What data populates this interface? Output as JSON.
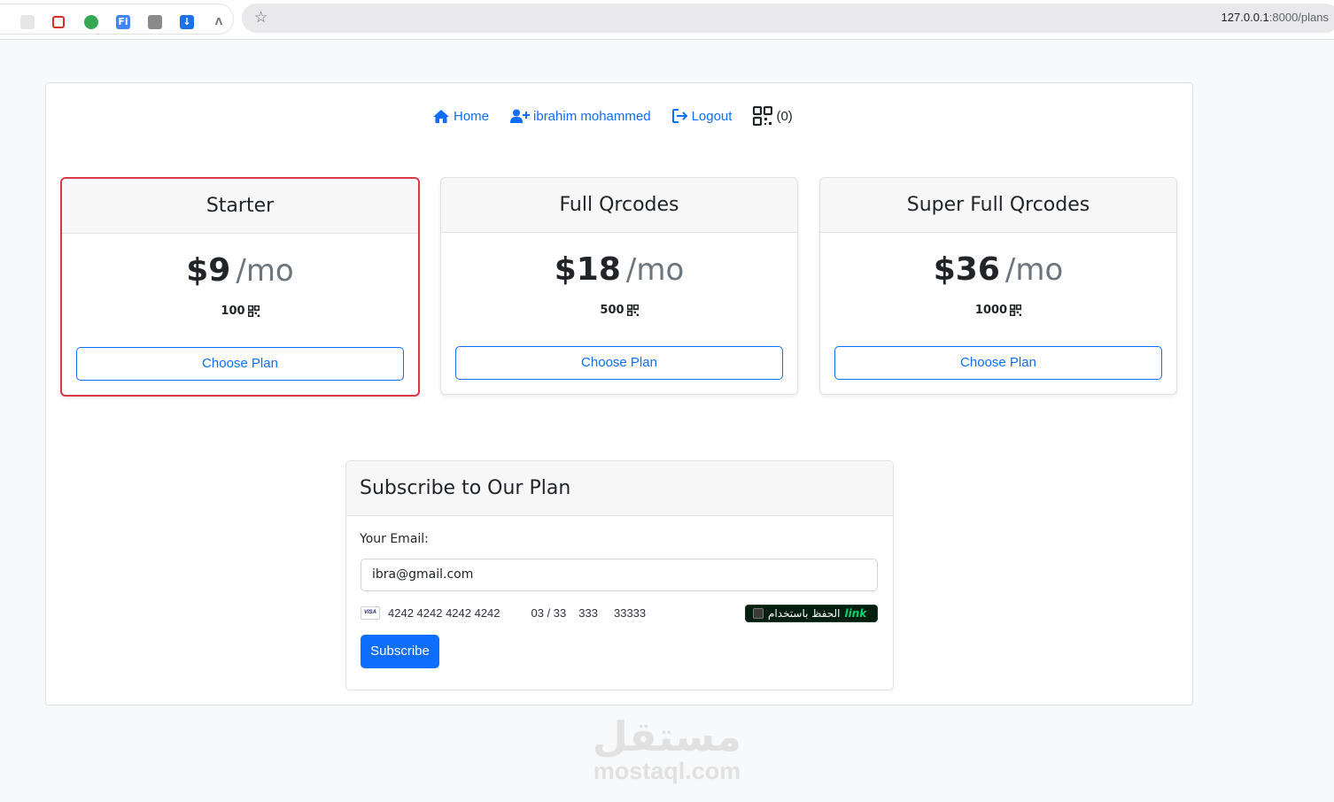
{
  "browser": {
    "url_host": "127.0.0.1",
    "url_path": ":8000/plans"
  },
  "nav": {
    "home": "Home",
    "user": "ibrahim mohammed",
    "logout": "Logout",
    "qr_count": "(0)"
  },
  "plans": [
    {
      "name": "Starter",
      "price": "$9",
      "period": "/mo",
      "quantity": "100",
      "button": "Choose Plan",
      "selected": true
    },
    {
      "name": "Full Qrcodes",
      "price": "$18",
      "period": "/mo",
      "quantity": "500",
      "button": "Choose Plan",
      "selected": false
    },
    {
      "name": "Super Full Qrcodes",
      "price": "$36",
      "period": "/mo",
      "quantity": "1000",
      "button": "Choose Plan",
      "selected": false
    }
  ],
  "subscribe": {
    "title": "Subscribe to Our Plan",
    "email_label": "Your Email:",
    "email_value": "ibra@gmail.com",
    "card_brand": "VISA",
    "card_number": "4242 4242 4242 4242",
    "card_expiry": "03 / 33",
    "card_cvc": "333",
    "card_zip": "33333",
    "link_text": "الحفظ باستخدام",
    "link_brand": "link",
    "button": "Subscribe"
  },
  "watermark": {
    "arabic": "مستقل",
    "latin": "mostaql.com"
  },
  "colors": {
    "primary": "#0d6efd",
    "selected_border": "#dc3545",
    "link_badge_bg": "#011e0f",
    "link_green": "#00d66f"
  }
}
